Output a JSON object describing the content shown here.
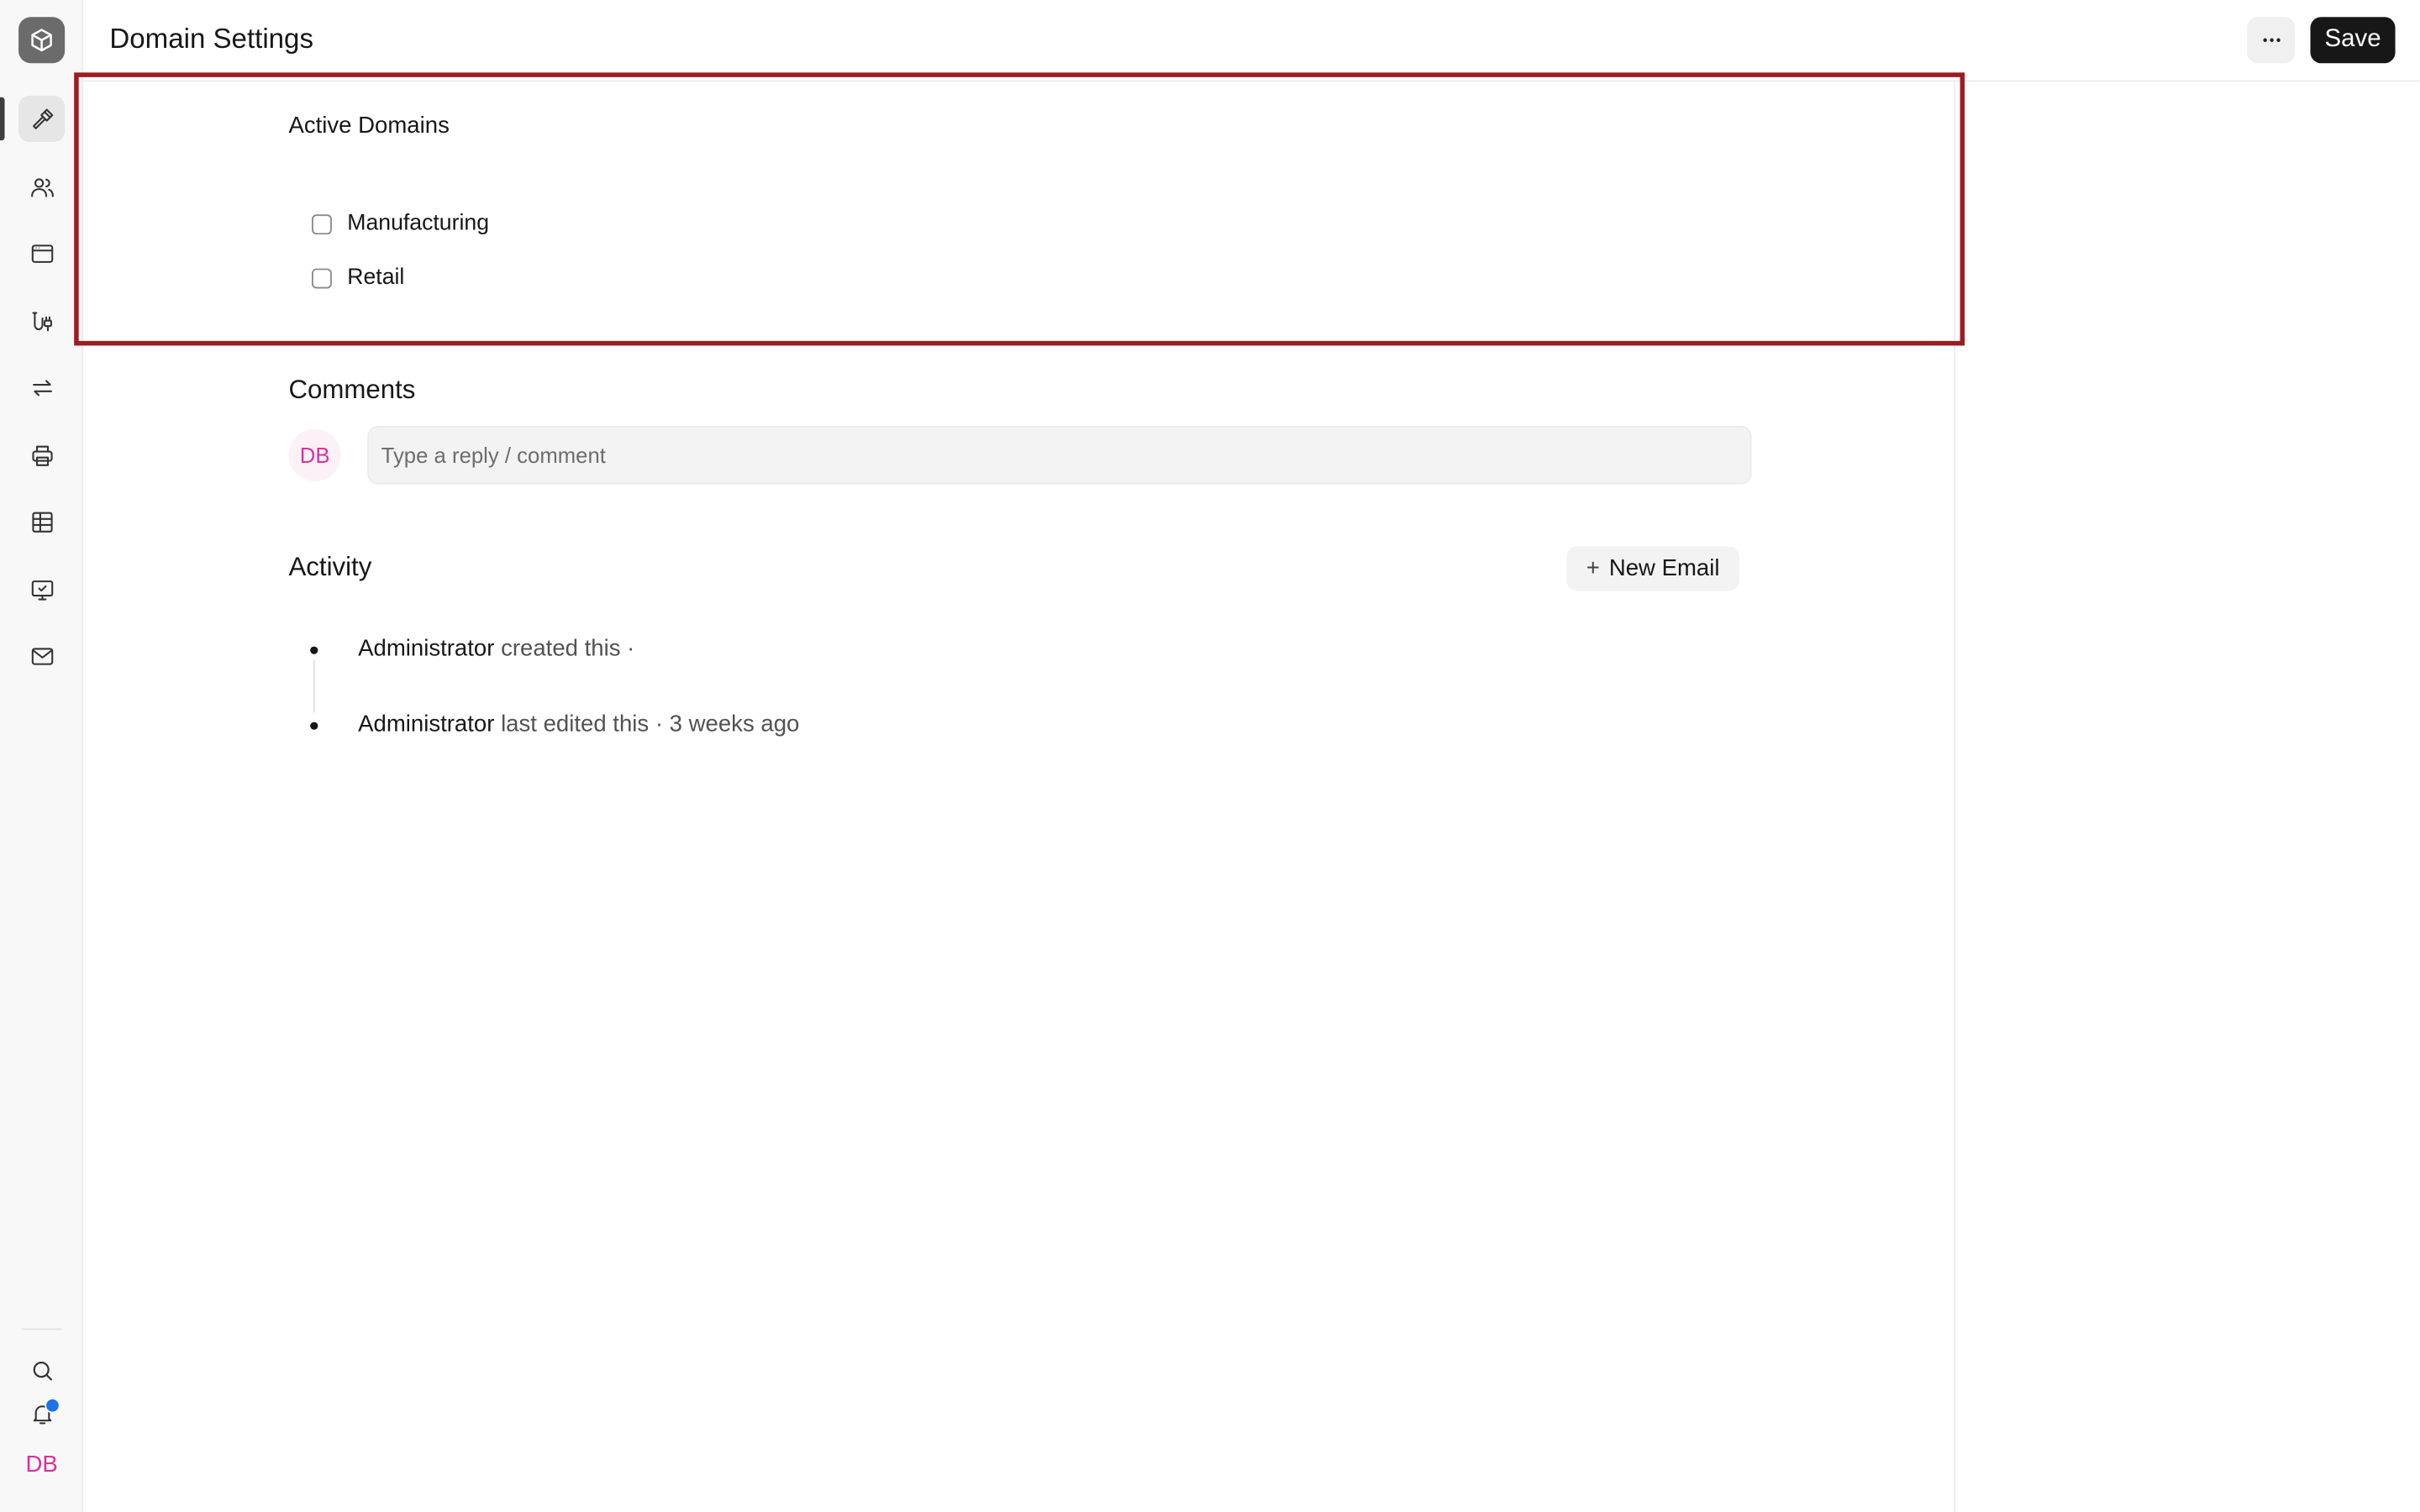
{
  "header": {
    "title": "Domain Settings",
    "save_label": "Save"
  },
  "sidebar": {
    "items": [
      {
        "icon": "hammer-icon",
        "active": true
      },
      {
        "icon": "users-icon",
        "active": false
      },
      {
        "icon": "browser-window-icon",
        "active": false
      },
      {
        "icon": "integration-icon",
        "active": false
      },
      {
        "icon": "repeat-arrows-icon",
        "active": false
      },
      {
        "icon": "printer-icon",
        "active": false
      },
      {
        "icon": "table-icon",
        "active": false
      },
      {
        "icon": "monitor-check-icon",
        "active": false
      },
      {
        "icon": "mail-icon",
        "active": false
      }
    ],
    "bottom": {
      "search_icon": "search-icon",
      "notifications_icon": "bell-icon",
      "user_initials": "DB"
    }
  },
  "domains": {
    "label": "Active Domains",
    "options": [
      {
        "label": "Manufacturing",
        "checked": false
      },
      {
        "label": "Retail",
        "checked": false
      }
    ]
  },
  "comments": {
    "title": "Comments",
    "avatar_initials": "DB",
    "placeholder": "Type a reply / comment"
  },
  "activity": {
    "title": "Activity",
    "new_email_label": "New Email",
    "items": [
      {
        "actor": "Administrator",
        "action": "created this ·"
      },
      {
        "actor": "Administrator",
        "action": "last edited this · 3 weeks ago"
      }
    ]
  },
  "colors": {
    "highlight_border": "#9c1c21",
    "avatar_text": "#d6339b",
    "notification_dot": "#1a73e8",
    "primary_button": "#171717"
  }
}
